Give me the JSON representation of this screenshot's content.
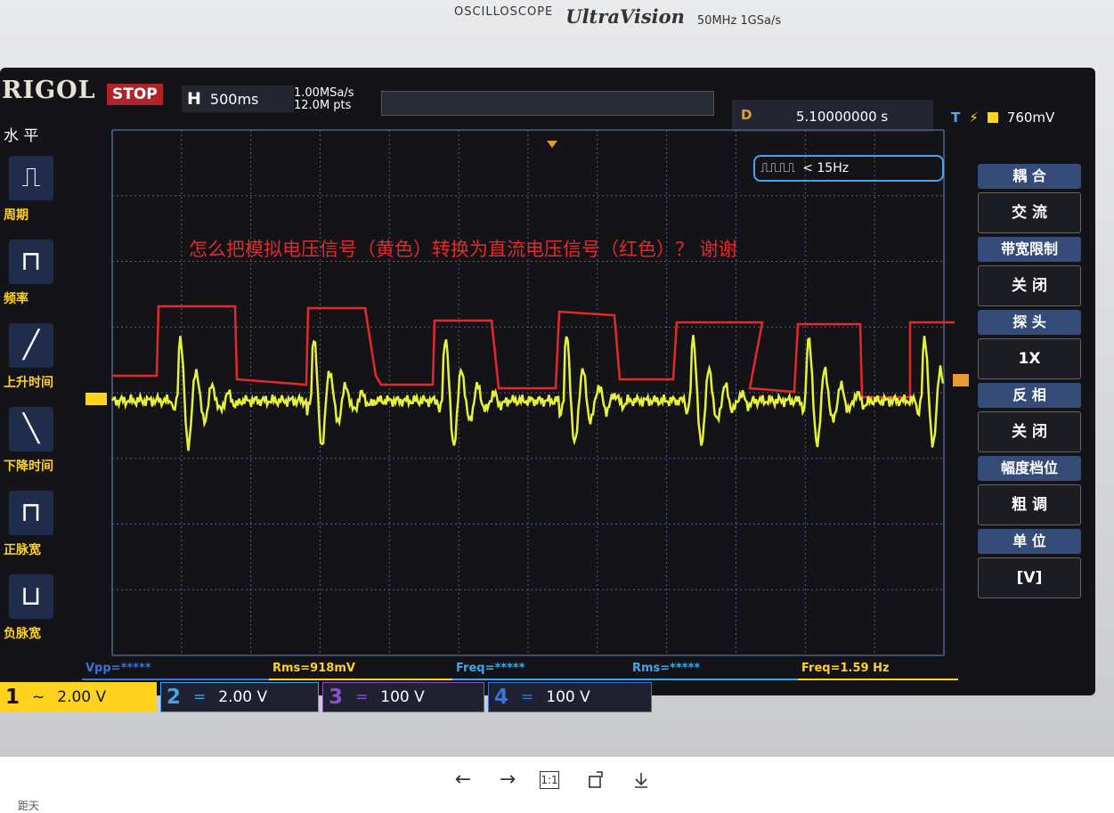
{
  "bezel": {
    "small": "OSCILLOSCOPE",
    "ultra": "UltraVision",
    "spec": "50MHz 1GSa/s"
  },
  "scope": {
    "logo": "RIGOL",
    "status": "STOP",
    "timebase_label": "H",
    "timebase": "500ms",
    "sample_rate": "1.00MSa/s",
    "points": "12.0M pts",
    "delay_label": "D",
    "delay": "5.10000000 s",
    "trigger_level": "760mV",
    "filter": "< 15Hz",
    "annotation": "怎么把模拟电压信号（黄色）转换为直流电压信号（红色）？ 谢谢"
  },
  "left_menu": {
    "title": "水 平",
    "items": [
      {
        "icon": "period-icon",
        "label": "周期"
      },
      {
        "icon": "frequency-icon",
        "label": "频率"
      },
      {
        "icon": "rise-time-icon",
        "label": "上升时间"
      },
      {
        "icon": "fall-time-icon",
        "label": "下降时间"
      },
      {
        "icon": "positive-pulse-width-icon",
        "label": "正脉宽"
      },
      {
        "icon": "negative-pulse-width-icon",
        "label": "负脉宽"
      }
    ]
  },
  "right_menu": [
    {
      "head": "耦 合",
      "value": "交 流"
    },
    {
      "head": "带宽限制",
      "value": "关 闭"
    },
    {
      "head": "探 头",
      "value": "1X"
    },
    {
      "head": "反 相",
      "value": "关 闭"
    },
    {
      "head": "幅度档位",
      "value": "粗 调"
    },
    {
      "head": "单 位",
      "value": "[V]"
    }
  ],
  "measurements": [
    {
      "text": "Vpp=*****",
      "color": "#3c73d8"
    },
    {
      "text": "Rms=918mV",
      "color": "#ffd21f"
    },
    {
      "text": "Freq=*****",
      "color": "#3ba8ee"
    },
    {
      "text": "Rms=*****",
      "color": "#3ba8ee"
    },
    {
      "text": "Freq=1.59 Hz",
      "color": "#ffd21f"
    }
  ],
  "channels": [
    {
      "num": "1",
      "coupling": "~",
      "scale": "2.00 V",
      "color": "#ffd21f"
    },
    {
      "num": "2",
      "coupling": "=",
      "scale": "2.00 V",
      "color": "#3aa8e8"
    },
    {
      "num": "3",
      "coupling": "=",
      "scale": "100 V",
      "color": "#8a52c9"
    },
    {
      "num": "4",
      "coupling": "=",
      "scale": "100 V",
      "color": "#3b73d8"
    }
  ],
  "viewer": {
    "prev": "←",
    "next": "→",
    "actual_size": "1:1",
    "rotate": "rotate-icon",
    "download": "download-icon",
    "footer": "距天"
  },
  "colors": {
    "signal": "#e6f23a",
    "annotation_line": "#e4292a",
    "grid": "#4d5f88"
  }
}
